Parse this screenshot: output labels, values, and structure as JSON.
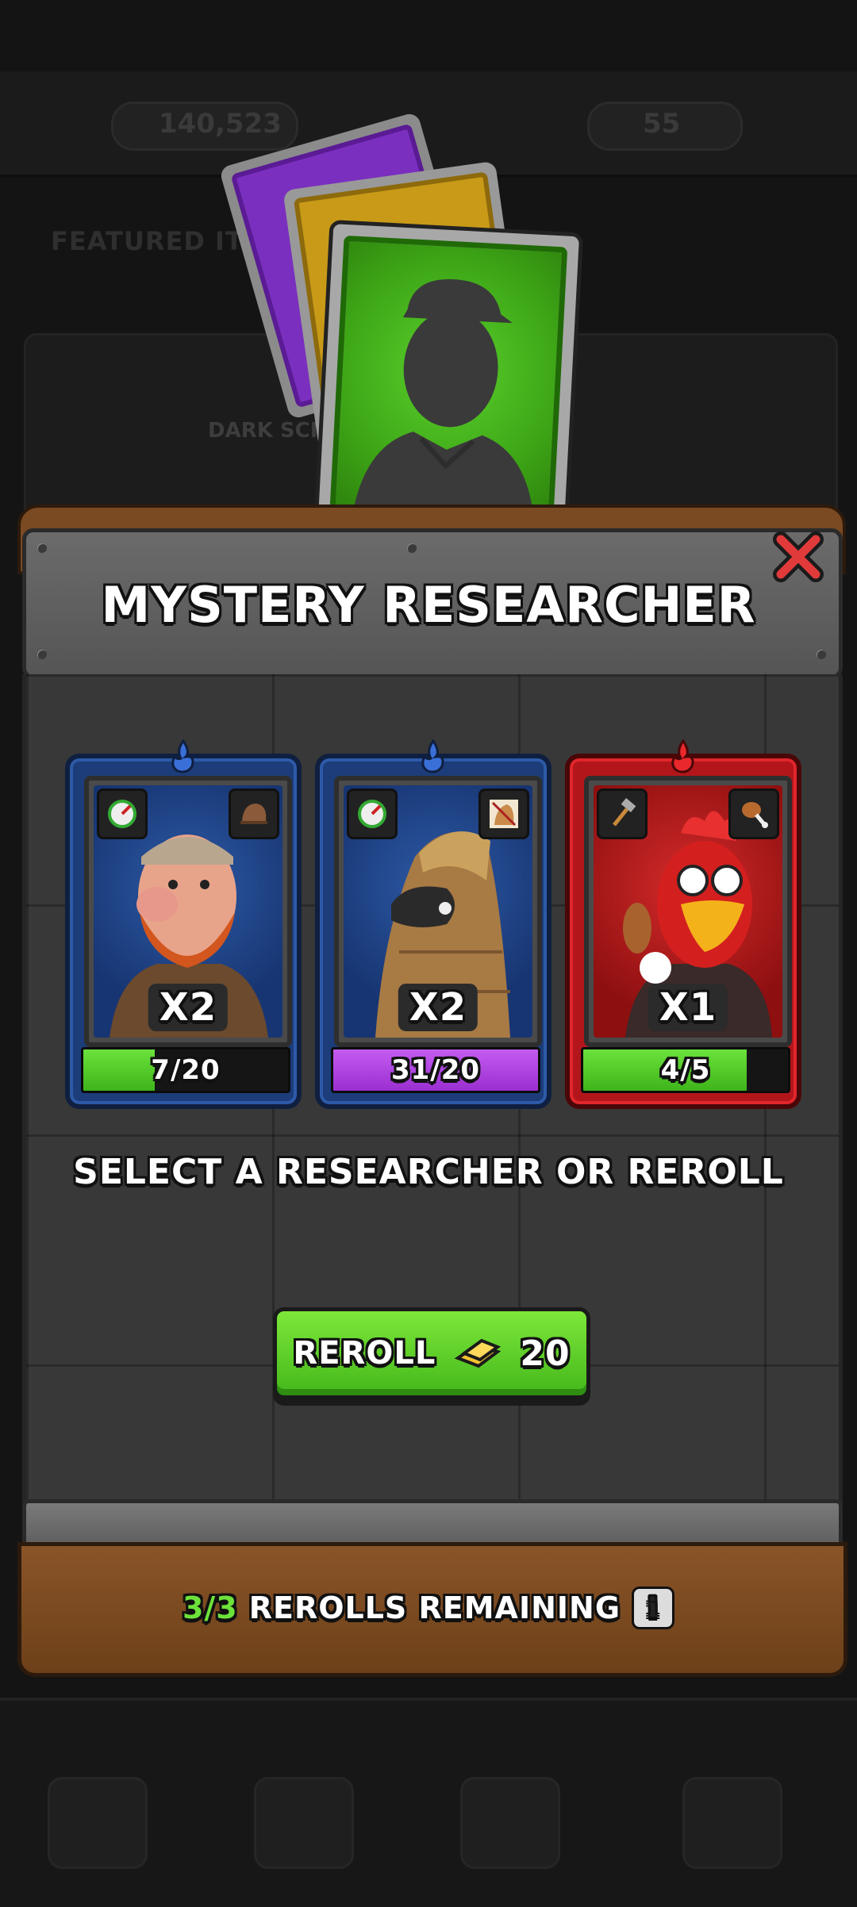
{
  "background": {
    "currency_a": "140,523",
    "currency_b": "55",
    "featured_label": "FEATURED ITEMS",
    "science_label": "DARK SCIENCE"
  },
  "modal": {
    "title": "MYSTERY RESEARCHER",
    "close_icon": "close-x-icon",
    "instruction": "SELECT A RESEARCHER OR REROLL",
    "reroll": {
      "label": "REROLL",
      "cost": "20",
      "icon": "gold-bar-icon"
    },
    "rerolls": {
      "count": "3/3",
      "text": "REROLLS REMAINING",
      "info_label": "i"
    }
  },
  "researchers": [
    {
      "name_hint": "bearded-man",
      "rarity": "blue",
      "rarity_icon": "blue-flame-icon",
      "left_icon": "speed-gauge-icon",
      "right_icon": "hat-icon",
      "multiplier": "X2",
      "progress_text": "7/20",
      "progress_fraction": 0.35,
      "fill": "green"
    },
    {
      "name_hint": "trojan-horse",
      "rarity": "blue",
      "rarity_icon": "blue-flame-icon",
      "left_icon": "speed-gauge-icon",
      "right_icon": "horse-icon",
      "multiplier": "X2",
      "progress_text": "31/20",
      "progress_fraction": 1.0,
      "fill": "purple"
    },
    {
      "name_hint": "rooster",
      "rarity": "red",
      "rarity_icon": "red-flame-icon",
      "left_icon": "hammer-icon",
      "right_icon": "chicken-leg-icon",
      "multiplier": "X1",
      "progress_text": "4/5",
      "progress_fraction": 0.8,
      "fill": "green"
    }
  ],
  "colors": {
    "accent_green": "#6de23a",
    "blue_card": "#1c3d7a",
    "red_card": "#b3161a",
    "purple_fill": "#9b2fd1"
  }
}
